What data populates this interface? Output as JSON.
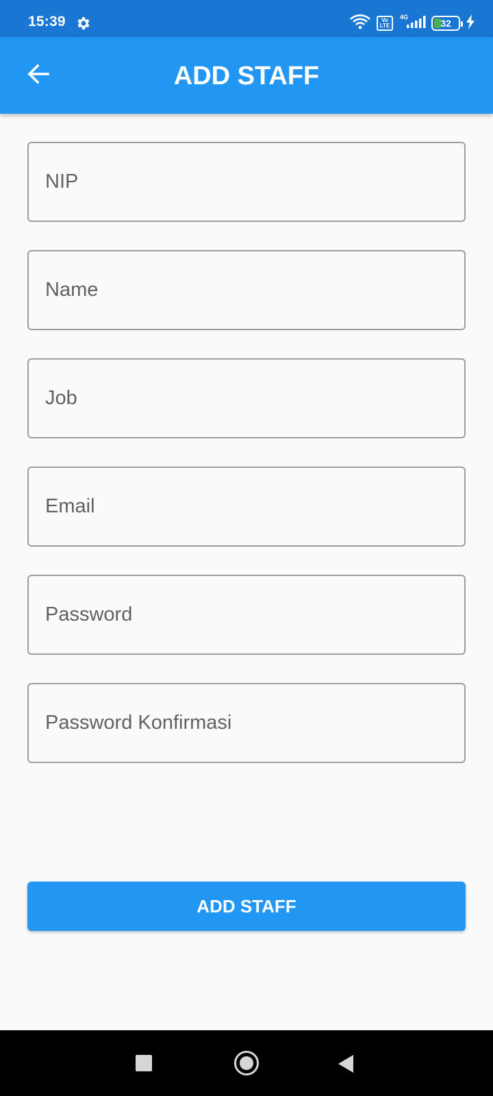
{
  "status_bar": {
    "time": "15:39",
    "settings_icon": "gear-icon",
    "wifi_icon": "wifi-icon",
    "volte_label": "Vo LTE",
    "network_label": "4G",
    "signal_icon": "signal-icon",
    "battery_level": "32",
    "charging_icon": "bolt-icon"
  },
  "app_bar": {
    "back_icon": "arrow-left-icon",
    "title": "ADD STAFF"
  },
  "form": {
    "fields": [
      {
        "placeholder": "NIP",
        "value": ""
      },
      {
        "placeholder": "Name",
        "value": ""
      },
      {
        "placeholder": "Job",
        "value": ""
      },
      {
        "placeholder": "Email",
        "value": ""
      },
      {
        "placeholder": "Password",
        "value": ""
      },
      {
        "placeholder": "Password Konfirmasi",
        "value": ""
      }
    ],
    "submit_label": "ADD STAFF"
  },
  "nav_bar": {
    "recents_icon": "square-icon",
    "home_icon": "circle-icon",
    "back_icon": "triangle-back-icon"
  },
  "colors": {
    "status_bar": "#1976d2",
    "app_bar": "#2196f3",
    "button": "#2196f3",
    "background": "#fafafa",
    "field_border": "#9e9e9e",
    "battery_fill": "#4caf50"
  }
}
